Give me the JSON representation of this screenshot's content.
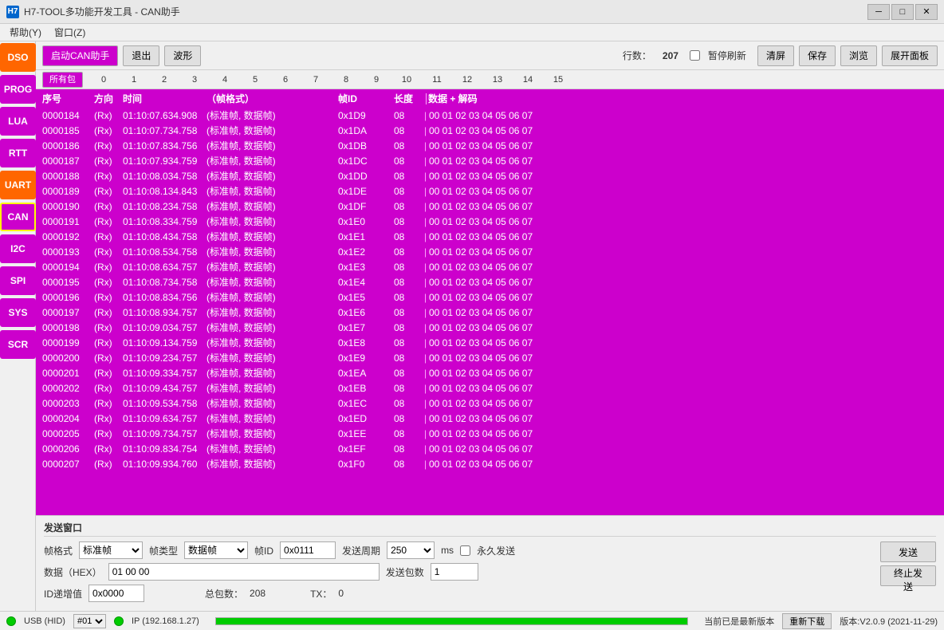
{
  "titlebar": {
    "icon": "H7",
    "title": "H7-TOOL多功能开发工具 - CAN助手",
    "min_btn": "─",
    "max_btn": "□",
    "close_btn": "✕"
  },
  "menubar": {
    "items": [
      "帮助(Y)",
      "窗口(Z)"
    ]
  },
  "sidebar": {
    "buttons": [
      {
        "label": "DSO",
        "class": "dso"
      },
      {
        "label": "PROG",
        "class": "prog"
      },
      {
        "label": "LUA",
        "class": "lua"
      },
      {
        "label": "RTT",
        "class": "rtt"
      },
      {
        "label": "UART",
        "class": "uart"
      },
      {
        "label": "CAN",
        "class": "can"
      },
      {
        "label": "I2C",
        "class": "i2c"
      },
      {
        "label": "SPI",
        "class": "spi"
      },
      {
        "label": "SYS",
        "class": "sys"
      },
      {
        "label": "SCR",
        "class": "scr"
      }
    ]
  },
  "toolbar": {
    "start_label": "启动CAN助手",
    "exit_label": "退出",
    "wave_label": "波形",
    "row_count_label": "行数：",
    "row_count_value": "207",
    "pause_label": "暂停刷新",
    "clear_label": "清屏",
    "save_label": "保存",
    "browse_label": "浏览",
    "expand_label": "展开面板"
  },
  "filter_tabs": {
    "all_label": "所有包",
    "cols": [
      "0",
      "1",
      "2",
      "3",
      "4",
      "5",
      "6",
      "7",
      "8",
      "9",
      "10",
      "11",
      "12",
      "13",
      "14",
      "15"
    ]
  },
  "table_header": {
    "seq": "序号",
    "dir": "方向",
    "time": "时间",
    "format": "（帧格式）",
    "id": "帧ID",
    "len": "长度",
    "data": "数据 + 解码"
  },
  "rows": [
    {
      "seq": "0000184",
      "dir": "(Rx)",
      "time": "01:10:07.634.908",
      "format": "(标准帧, 数据帧)",
      "id": "0x1D9",
      "len": "08",
      "data": "00  01  02  03  04  05  06  07"
    },
    {
      "seq": "0000185",
      "dir": "(Rx)",
      "time": "01:10:07.734.758",
      "format": "(标准帧, 数据帧)",
      "id": "0x1DA",
      "len": "08",
      "data": "00  01  02  03  04  05  06  07"
    },
    {
      "seq": "0000186",
      "dir": "(Rx)",
      "time": "01:10:07.834.756",
      "format": "(标准帧, 数据帧)",
      "id": "0x1DB",
      "len": "08",
      "data": "00  01  02  03  04  05  06  07"
    },
    {
      "seq": "0000187",
      "dir": "(Rx)",
      "time": "01:10:07.934.759",
      "format": "(标准帧, 数据帧)",
      "id": "0x1DC",
      "len": "08",
      "data": "00  01  02  03  04  05  06  07"
    },
    {
      "seq": "0000188",
      "dir": "(Rx)",
      "time": "01:10:08.034.758",
      "format": "(标准帧, 数据帧)",
      "id": "0x1DD",
      "len": "08",
      "data": "00  01  02  03  04  05  06  07"
    },
    {
      "seq": "0000189",
      "dir": "(Rx)",
      "time": "01:10:08.134.843",
      "format": "(标准帧, 数据帧)",
      "id": "0x1DE",
      "len": "08",
      "data": "00  01  02  03  04  05  06  07"
    },
    {
      "seq": "0000190",
      "dir": "(Rx)",
      "time": "01:10:08.234.758",
      "format": "(标准帧, 数据帧)",
      "id": "0x1DF",
      "len": "08",
      "data": "00  01  02  03  04  05  06  07"
    },
    {
      "seq": "0000191",
      "dir": "(Rx)",
      "time": "01:10:08.334.759",
      "format": "(标准帧, 数据帧)",
      "id": "0x1E0",
      "len": "08",
      "data": "00  01  02  03  04  05  06  07"
    },
    {
      "seq": "0000192",
      "dir": "(Rx)",
      "time": "01:10:08.434.758",
      "format": "(标准帧, 数据帧)",
      "id": "0x1E1",
      "len": "08",
      "data": "00  01  02  03  04  05  06  07"
    },
    {
      "seq": "0000193",
      "dir": "(Rx)",
      "time": "01:10:08.534.758",
      "format": "(标准帧, 数据帧)",
      "id": "0x1E2",
      "len": "08",
      "data": "00  01  02  03  04  05  06  07"
    },
    {
      "seq": "0000194",
      "dir": "(Rx)",
      "time": "01:10:08.634.757",
      "format": "(标准帧, 数据帧)",
      "id": "0x1E3",
      "len": "08",
      "data": "00  01  02  03  04  05  06  07"
    },
    {
      "seq": "0000195",
      "dir": "(Rx)",
      "time": "01:10:08.734.758",
      "format": "(标准帧, 数据帧)",
      "id": "0x1E4",
      "len": "08",
      "data": "00  01  02  03  04  05  06  07"
    },
    {
      "seq": "0000196",
      "dir": "(Rx)",
      "time": "01:10:08.834.756",
      "format": "(标准帧, 数据帧)",
      "id": "0x1E5",
      "len": "08",
      "data": "00  01  02  03  04  05  06  07"
    },
    {
      "seq": "0000197",
      "dir": "(Rx)",
      "time": "01:10:08.934.757",
      "format": "(标准帧, 数据帧)",
      "id": "0x1E6",
      "len": "08",
      "data": "00  01  02  03  04  05  06  07"
    },
    {
      "seq": "0000198",
      "dir": "(Rx)",
      "time": "01:10:09.034.757",
      "format": "(标准帧, 数据帧)",
      "id": "0x1E7",
      "len": "08",
      "data": "00  01  02  03  04  05  06  07"
    },
    {
      "seq": "0000199",
      "dir": "(Rx)",
      "time": "01:10:09.134.759",
      "format": "(标准帧, 数据帧)",
      "id": "0x1E8",
      "len": "08",
      "data": "00  01  02  03  04  05  06  07"
    },
    {
      "seq": "0000200",
      "dir": "(Rx)",
      "time": "01:10:09.234.757",
      "format": "(标准帧, 数据帧)",
      "id": "0x1E9",
      "len": "08",
      "data": "00  01  02  03  04  05  06  07"
    },
    {
      "seq": "0000201",
      "dir": "(Rx)",
      "time": "01:10:09.334.757",
      "format": "(标准帧, 数据帧)",
      "id": "0x1EA",
      "len": "08",
      "data": "00  01  02  03  04  05  06  07"
    },
    {
      "seq": "0000202",
      "dir": "(Rx)",
      "time": "01:10:09.434.757",
      "format": "(标准帧, 数据帧)",
      "id": "0x1EB",
      "len": "08",
      "data": "00  01  02  03  04  05  06  07"
    },
    {
      "seq": "0000203",
      "dir": "(Rx)",
      "time": "01:10:09.534.758",
      "format": "(标准帧, 数据帧)",
      "id": "0x1EC",
      "len": "08",
      "data": "00  01  02  03  04  05  06  07"
    },
    {
      "seq": "0000204",
      "dir": "(Rx)",
      "time": "01:10:09.634.757",
      "format": "(标准帧, 数据帧)",
      "id": "0x1ED",
      "len": "08",
      "data": "00  01  02  03  04  05  06  07"
    },
    {
      "seq": "0000205",
      "dir": "(Rx)",
      "time": "01:10:09.734.757",
      "format": "(标准帧, 数据帧)",
      "id": "0x1EE",
      "len": "08",
      "data": "00  01  02  03  04  05  06  07"
    },
    {
      "seq": "0000206",
      "dir": "(Rx)",
      "time": "01:10:09.834.754",
      "format": "(标准帧, 数据帧)",
      "id": "0x1EF",
      "len": "08",
      "data": "00  01  02  03  04  05  06  07"
    },
    {
      "seq": "0000207",
      "dir": "(Rx)",
      "time": "01:10:09.934.760",
      "format": "(标准帧, 数据帧)",
      "id": "0x1F0",
      "len": "08",
      "data": "00  01  02  03  04  05  06  07"
    }
  ],
  "send_panel": {
    "title": "发送窗口",
    "frame_format_label": "帧格式",
    "frame_format_value": "标准帧",
    "frame_type_label": "帧类型",
    "frame_type_value": "数据帧",
    "frame_id_label": "帧ID",
    "frame_id_value": "0x0111",
    "send_period_label": "发送周期",
    "send_period_value": "250",
    "ms_label": "ms",
    "forever_label": "永久发送",
    "data_label": "数据（HEX）",
    "data_value": "01 00 00",
    "send_count_label": "发送包数",
    "send_count_value": "1",
    "id_increment_label": "ID递增值",
    "id_increment_value": "0x0000",
    "total_packets_label": "总包数：",
    "total_packets_value": "208",
    "tx_label": "TX：",
    "tx_value": "0",
    "send_btn_label": "发送",
    "stop_btn_label": "终止发送"
  },
  "statusbar": {
    "usb_label": "USB (HID)",
    "port_label": "#01",
    "ip_label": "IP (192.168.1.27)",
    "status_text": "当前已是最新版本",
    "update_btn_label": "重新下载",
    "version": "版本:V2.0.9 (2021-11-29)"
  }
}
